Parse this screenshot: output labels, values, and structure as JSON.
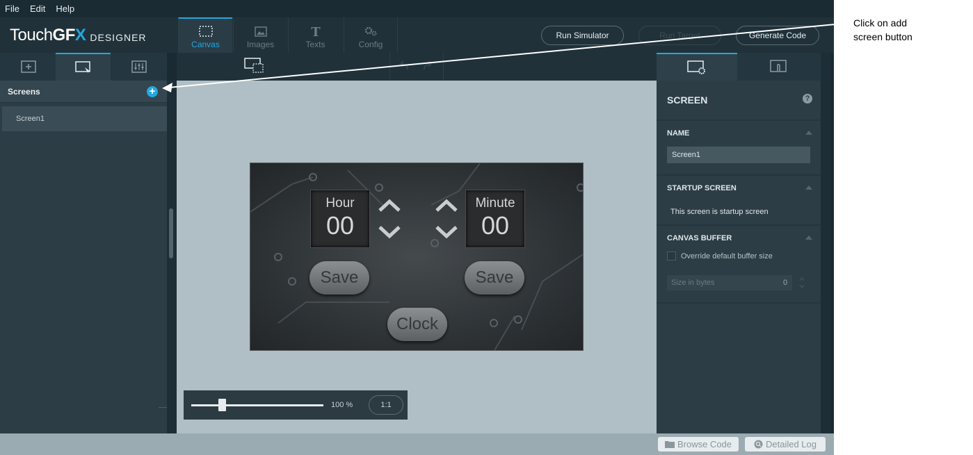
{
  "menu": [
    "File",
    "Edit",
    "Help"
  ],
  "logo": {
    "touch": "Touch",
    "gfx": "GF",
    "x": "X",
    "designer": "DESIGNER"
  },
  "main_tabs": [
    {
      "label": "Canvas",
      "icon": "canvas-icon",
      "active": true
    },
    {
      "label": "Images",
      "icon": "image-icon",
      "active": false
    },
    {
      "label": "Texts",
      "icon": "text-icon",
      "active": false
    },
    {
      "label": "Config",
      "icon": "gear-icon",
      "active": false
    }
  ],
  "header_buttons": {
    "run_simulator": "Run Simulator",
    "run_target": "Run Target",
    "generate_code": "Generate Code"
  },
  "left_panel": {
    "title": "Screens",
    "add_button": "+",
    "screens": [
      "Screen1"
    ]
  },
  "preview": {
    "hour_label": "Hour",
    "hour_value": "00",
    "minute_label": "Minute",
    "minute_value": "00",
    "save1": "Save",
    "save2": "Save",
    "clock": "Clock"
  },
  "zoom": {
    "percent_label": "100 %",
    "reset": "1:1",
    "level": 0.2
  },
  "right_panel": {
    "title": "SCREEN",
    "help": "?",
    "name_section": "NAME",
    "name_value": "Screen1",
    "startup_section": "STARTUP SCREEN",
    "startup_text": "This screen is startup screen",
    "buffer_section": "CANVAS BUFFER",
    "override_label": "Override default buffer size",
    "size_placeholder": "Size in bytes",
    "size_value": "0"
  },
  "status": {
    "browse_code": "Browse Code",
    "detailed_log": "Detailed Log"
  },
  "annotation": {
    "line1": "Click on add",
    "line2": "screen button"
  },
  "colors": {
    "accent": "#22a8e0",
    "background": "#1a2a32",
    "canvas": "#afbfc5"
  }
}
